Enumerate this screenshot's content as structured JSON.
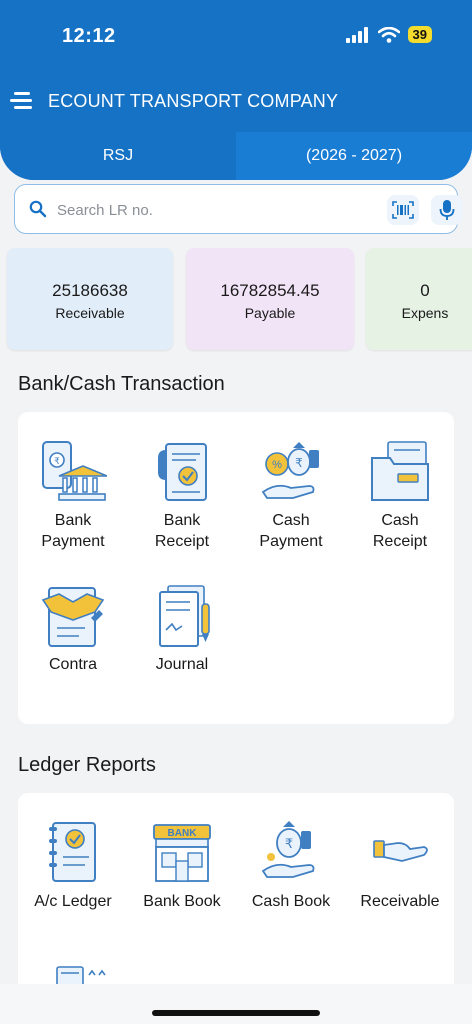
{
  "status_bar": {
    "time": "12:12",
    "battery": "39"
  },
  "app_bar": {
    "title": "ECOUNT TRANSPORT COMPANY"
  },
  "tabs": [
    {
      "label": "RSJ"
    },
    {
      "label": "(2026 - 2027)"
    }
  ],
  "search": {
    "placeholder": "Search LR no."
  },
  "summary": [
    {
      "value": "25186638",
      "label": "Receivable"
    },
    {
      "value": "16782854.45",
      "label": "Payable"
    },
    {
      "value": "0",
      "label": "Expens"
    }
  ],
  "bank_cash": {
    "title": "Bank/Cash Transaction",
    "items": [
      {
        "label": "Bank\nPayment",
        "icon": "bank-payment-icon"
      },
      {
        "label": "Bank\nReceipt",
        "icon": "bank-receipt-icon"
      },
      {
        "label": "Cash\nPayment",
        "icon": "cash-payment-icon"
      },
      {
        "label": "Cash\nReceipt",
        "icon": "cash-receipt-icon"
      },
      {
        "label": "Contra",
        "icon": "contra-icon"
      },
      {
        "label": "Journal",
        "icon": "journal-icon"
      }
    ]
  },
  "ledger_reports": {
    "title": "Ledger Reports",
    "items": [
      {
        "label": "A/c Ledger",
        "icon": "ac-ledger-icon"
      },
      {
        "label": "Bank Book",
        "icon": "bank-book-icon"
      },
      {
        "label": "Cash Book",
        "icon": "cash-book-icon"
      },
      {
        "label": "Receivable",
        "icon": "receivable-icon"
      }
    ],
    "sign_text": "BANK"
  },
  "colors": {
    "primary": "#1572c4",
    "accent": "#f2c23a",
    "icon_blue": "#3f7fc2"
  }
}
